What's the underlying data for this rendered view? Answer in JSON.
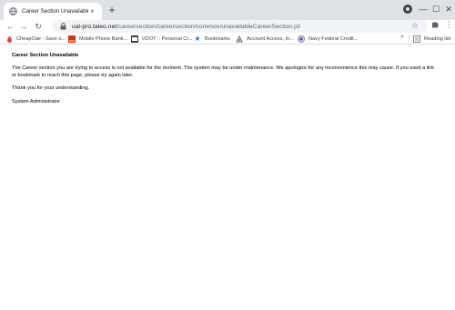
{
  "browser": {
    "tab": {
      "title": "Career Section Unavailable",
      "favicon": "globe-icon",
      "close_glyph": "×"
    },
    "new_tab_glyph": "+",
    "window_controls": {
      "minimize": "—",
      "maximize": "☐",
      "close": "✕"
    },
    "nav": {
      "back": "←",
      "forward": "→",
      "reload": "↻"
    },
    "address": {
      "host": "ual-pro.taleo.net",
      "path": "/careersection/careersection/common/unavailableCareerSection.jsf"
    },
    "bookmarks": [
      {
        "label": "CheapOair - Save o...",
        "icon": "cheapoair-icon",
        "color": "#e8453c"
      },
      {
        "label": "Mobile Phone Bank...",
        "icon": "bank-icon",
        "color": "#d93025"
      },
      {
        "label": "VDOT :: Personal Cr...",
        "icon": "vdot-icon",
        "color": "#3c4043"
      },
      {
        "label": "Bookmarks",
        "icon": "star-icon",
        "color": "#1a73e8"
      },
      {
        "label": "Account Access, In...",
        "icon": "account-icon",
        "color": "#5f6368"
      },
      {
        "label": "Navy Federal Credit...",
        "icon": "navy-federal-icon",
        "color": "#5f6368"
      }
    ],
    "more_bookmarks_glyph": "»",
    "reading_list": "Reading list"
  },
  "page": {
    "heading": "Career Section Unavailable",
    "message": "The Career section you are trying to access is not available for the moment. The system may be under maintenance. We apologize for any inconvenience this may cause. If you used a link or bookmark to reach this page, please try again later.",
    "thanks": "Thank you for your understanding.",
    "signature": "System Administrator"
  }
}
